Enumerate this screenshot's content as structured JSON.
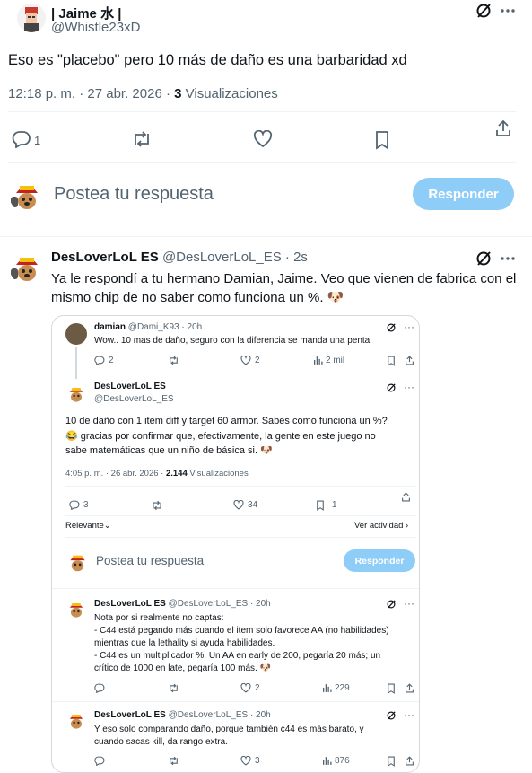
{
  "main_post": {
    "display_name": "| Jaime 水 |",
    "handle": "@Whistle23xD",
    "text": "Eso es \"placebo\" pero 10 más de daño es una barbaridad xd",
    "time": "12:18 p. m. · 27 abr. 2026 ·",
    "views_count": "3",
    "views_label": "Visualizaciones",
    "reply_count": "1"
  },
  "composer": {
    "placeholder": "Postea tu respuesta",
    "reply_button": "Responder"
  },
  "reply": {
    "display_name": "DesLoverLoL ES",
    "handle": "@DesLoverLoL_ES · 2s",
    "text": "Ya le respondí a tu hermano Damian, Jaime. Veo que vienen de fabrica con el mismo chip de no saber como funciona un %. 🐶"
  },
  "embed": {
    "damian": {
      "name": "damian",
      "handle": "@Dami_K93 · 20h",
      "text": "Wow.. 10 mas de daño, seguro con la diferencia se manda una penta",
      "replies": "2",
      "likes": "2",
      "views": "2 mil"
    },
    "main": {
      "name": "DesLoverLoL ES",
      "handle": "@DesLoverLoL_ES",
      "line1": "10 de daño con 1 item diff y target 60 armor. Sabes como funciona un %?",
      "line2": "😂 gracias por confirmar que, efectivamente, la gente en este juego no",
      "line3": "sabe matemáticas que un niño de básica si. 🐶",
      "time": "4:05 p. m. · 26 abr. 2026 ·",
      "views_count": "2.144",
      "views_label": "Visualizaciones",
      "replies": "3",
      "likes": "34",
      "bookmarks": "1"
    },
    "sort_label": "Relevante",
    "activity_label": "Ver actividad",
    "composer_placeholder": "Postea tu respuesta",
    "composer_button": "Responder",
    "reply1": {
      "name": "DesLoverLoL ES",
      "handle": "@DesLoverLoL_ES · 20h",
      "lines": [
        "Nota por si realmente no captas:",
        "- C44 está pegando más cuando el item solo favorece AA (no habilidades)",
        "mientras que la lethality si ayuda habilidades.",
        "- C44 es un multiplicador %. Un AA en early de 200, pegaría 20 más; un",
        "crítico de 1000 en late, pegaría 100 más. 🐶"
      ],
      "likes": "2",
      "views": "229"
    },
    "reply2": {
      "name": "DesLoverLoL ES",
      "handle": "@DesLoverLoL_ES · 20h",
      "lines": [
        "Y eso solo comparando daño, porque también c44 es más barato, y",
        "cuando sacas kill, da rango extra."
      ],
      "likes": "3",
      "views": "876"
    }
  },
  "colors": {
    "accent_disabled": "#8ecdf8",
    "text": "#0f1419",
    "muted": "#536471",
    "border": "#eff3f4"
  }
}
